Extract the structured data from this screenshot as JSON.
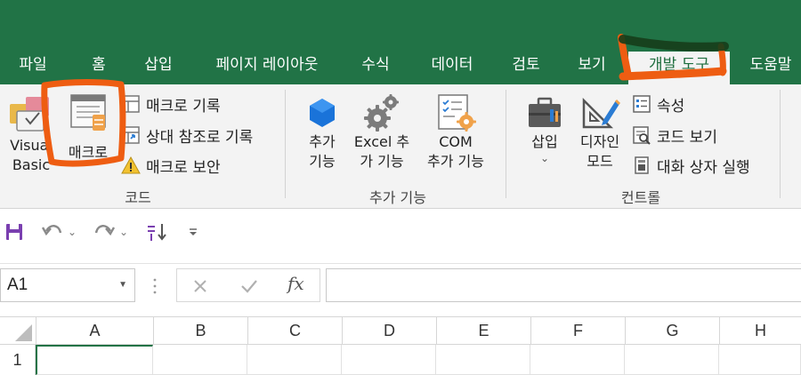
{
  "ribbon_tabs": [
    {
      "label": "파일"
    },
    {
      "label": "홈"
    },
    {
      "label": "삽입"
    },
    {
      "label": "페이지 레이아웃"
    },
    {
      "label": "수식"
    },
    {
      "label": "데이터"
    },
    {
      "label": "검토"
    },
    {
      "label": "보기"
    },
    {
      "label": "개발 도구",
      "active": true
    },
    {
      "label": "도움말"
    }
  ],
  "code_group": {
    "label": "코드",
    "visual_basic": {
      "line1": "Visual",
      "line2": "Basic"
    },
    "macro": "매크로",
    "record_macro": "매크로 기록",
    "relative_ref": "상대 참조로 기록",
    "macro_security": "매크로 보안"
  },
  "addins_group": {
    "label": "추가 기능",
    "addins": {
      "line1": "추가",
      "line2": "기능"
    },
    "excel_addins": {
      "line1": "Excel 추",
      "line2": "가 기능"
    },
    "com_addins": {
      "line1": "COM",
      "line2": "추가 기능"
    }
  },
  "controls_group": {
    "label": "컨트롤",
    "insert": {
      "line1": "삽입",
      "line2": "⌄"
    },
    "design_mode": {
      "line1": "디자인",
      "line2": "모드"
    },
    "properties": "속성",
    "view_code": "코드 보기",
    "run_dialog": "대화 상자 실행"
  },
  "formula_bar": {
    "name_box": "A1",
    "fx": "fx",
    "formula_value": ""
  },
  "grid": {
    "columns": [
      "A",
      "B",
      "C",
      "D",
      "E",
      "F",
      "G",
      "H"
    ],
    "rows": [
      "1"
    ]
  },
  "colors": {
    "title_band": "#217346",
    "ribbon": "#f3f3f3",
    "annotation": "#ee5d12"
  }
}
